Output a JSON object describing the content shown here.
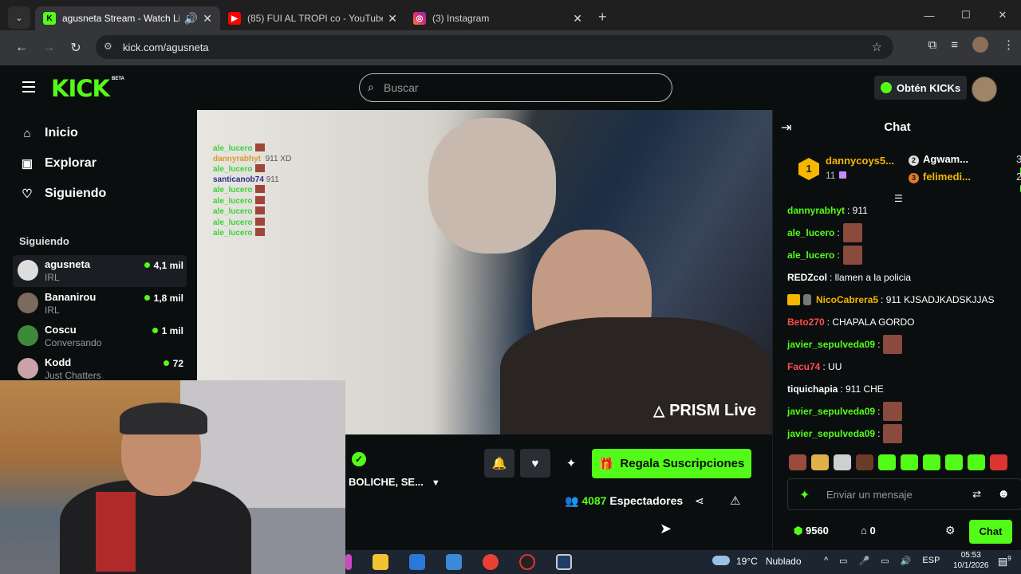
{
  "browser": {
    "tabs": [
      {
        "title": "agusneta Stream - Watch Li",
        "favicon": "kick-favicon",
        "active": true,
        "extra": "🔊"
      },
      {
        "title": "(85) FUI AL TROPI co - YouTube",
        "favicon": "youtube-favicon",
        "active": false
      },
      {
        "title": "(3) Instagram",
        "favicon": "instagram-favicon",
        "active": false
      }
    ],
    "url": "kick.com/agusneta"
  },
  "header": {
    "logo": "KICK",
    "beta": "BETA",
    "search_placeholder": "Buscar",
    "kicks_button": "Obtén KICKs"
  },
  "sidebar": {
    "nav": [
      {
        "label": "Inicio",
        "icon": "home-icon"
      },
      {
        "label": "Explorar",
        "icon": "compass-icon"
      },
      {
        "label": "Siguiendo",
        "icon": "heart-icon"
      }
    ],
    "following_title": "Siguiendo",
    "following": [
      {
        "name": "agusneta",
        "category": "IRL",
        "viewers": "4,1 mil"
      },
      {
        "name": "Bananirou",
        "category": "IRL",
        "viewers": "1,8 mil"
      },
      {
        "name": "Coscu",
        "category": "Conversando",
        "viewers": "1 mil"
      },
      {
        "name": "Kodd",
        "category": "Just Chatters",
        "viewers": "72"
      }
    ]
  },
  "video": {
    "overlay_chat": [
      {
        "user": "ale_lucero",
        "msg": "",
        "emote": true
      },
      {
        "user": "dannyrabhyt",
        "msg": "911 XD",
        "emote": false
      },
      {
        "user": "ale_lucero",
        "msg": "",
        "emote": true
      },
      {
        "user": "santicanob74",
        "msg": "911",
        "emote": false
      },
      {
        "user": "ale_lucero",
        "msg": "",
        "emote": true
      },
      {
        "user": "ale_lucero",
        "msg": "",
        "emote": true
      },
      {
        "user": "ale_lucero",
        "msg": "",
        "emote": true
      },
      {
        "user": "ale_lucero",
        "msg": "",
        "emote": true
      },
      {
        "user": "ale_lucero",
        "msg": "",
        "emote": true
      }
    ],
    "watermark": "PRISM Live"
  },
  "stream_info": {
    "title": "BOLICHE, SE...",
    "gift_button": "Regala Suscripciones",
    "viewer_count": "4087",
    "viewer_label": "Espectadores"
  },
  "chat": {
    "title": "Chat",
    "leaderboard": [
      {
        "rank": "1",
        "name": "dannycoys5...",
        "count": "11"
      },
      {
        "rank": "2",
        "name": "Agwam...",
        "count": "3"
      },
      {
        "rank": "3",
        "name": "felimedi...",
        "count": "2"
      }
    ],
    "messages": [
      {
        "user": "dannyrabhyt",
        "color": "#53fc18",
        "text": ": 911",
        "emote": false
      },
      {
        "user": "ale_lucero",
        "color": "#53fc18",
        "text": ":",
        "emote": true
      },
      {
        "user": "ale_lucero",
        "color": "#53fc18",
        "text": ":",
        "emote": true
      },
      {
        "user": "REDZcol",
        "color": "#ffffff",
        "text": ": llamen a la policia",
        "emote": false
      },
      {
        "user": "NicoCabrera5",
        "color": "#f5b700",
        "text": ": 911 KJSADJKADSKJJAS",
        "emote": false
      },
      {
        "user": "Beto270",
        "color": "#ff4d4d",
        "text": ": CHAPALA GORDO",
        "emote": false
      },
      {
        "user": "javier_sepulveda09",
        "color": "#53fc18",
        "text": ":",
        "emote": true
      },
      {
        "user": "Facu74",
        "color": "#ff4d4d",
        "text": ": UU",
        "emote": false
      },
      {
        "user": "tiquichapia",
        "color": "#ffffff",
        "text": ": 911 CHE",
        "emote": false
      },
      {
        "user": "javier_sepulveda09",
        "color": "#53fc18",
        "text": ":",
        "emote": true
      },
      {
        "user": "javier_sepulveda09",
        "color": "#53fc18",
        "text": ":",
        "emote": true
      }
    ],
    "input_placeholder": "Enviar un mensaje",
    "points": "9560",
    "claims": "0",
    "chat_button": "Chat"
  },
  "taskbar": {
    "temperature": "19°C",
    "weather": "Nublado",
    "lang": "ESP",
    "time": "05:53",
    "date": "10/1/2026",
    "notifications": "9"
  },
  "colors": {
    "accent": "#53fc18",
    "background": "#0b0e0f",
    "gold": "#f5b700"
  }
}
